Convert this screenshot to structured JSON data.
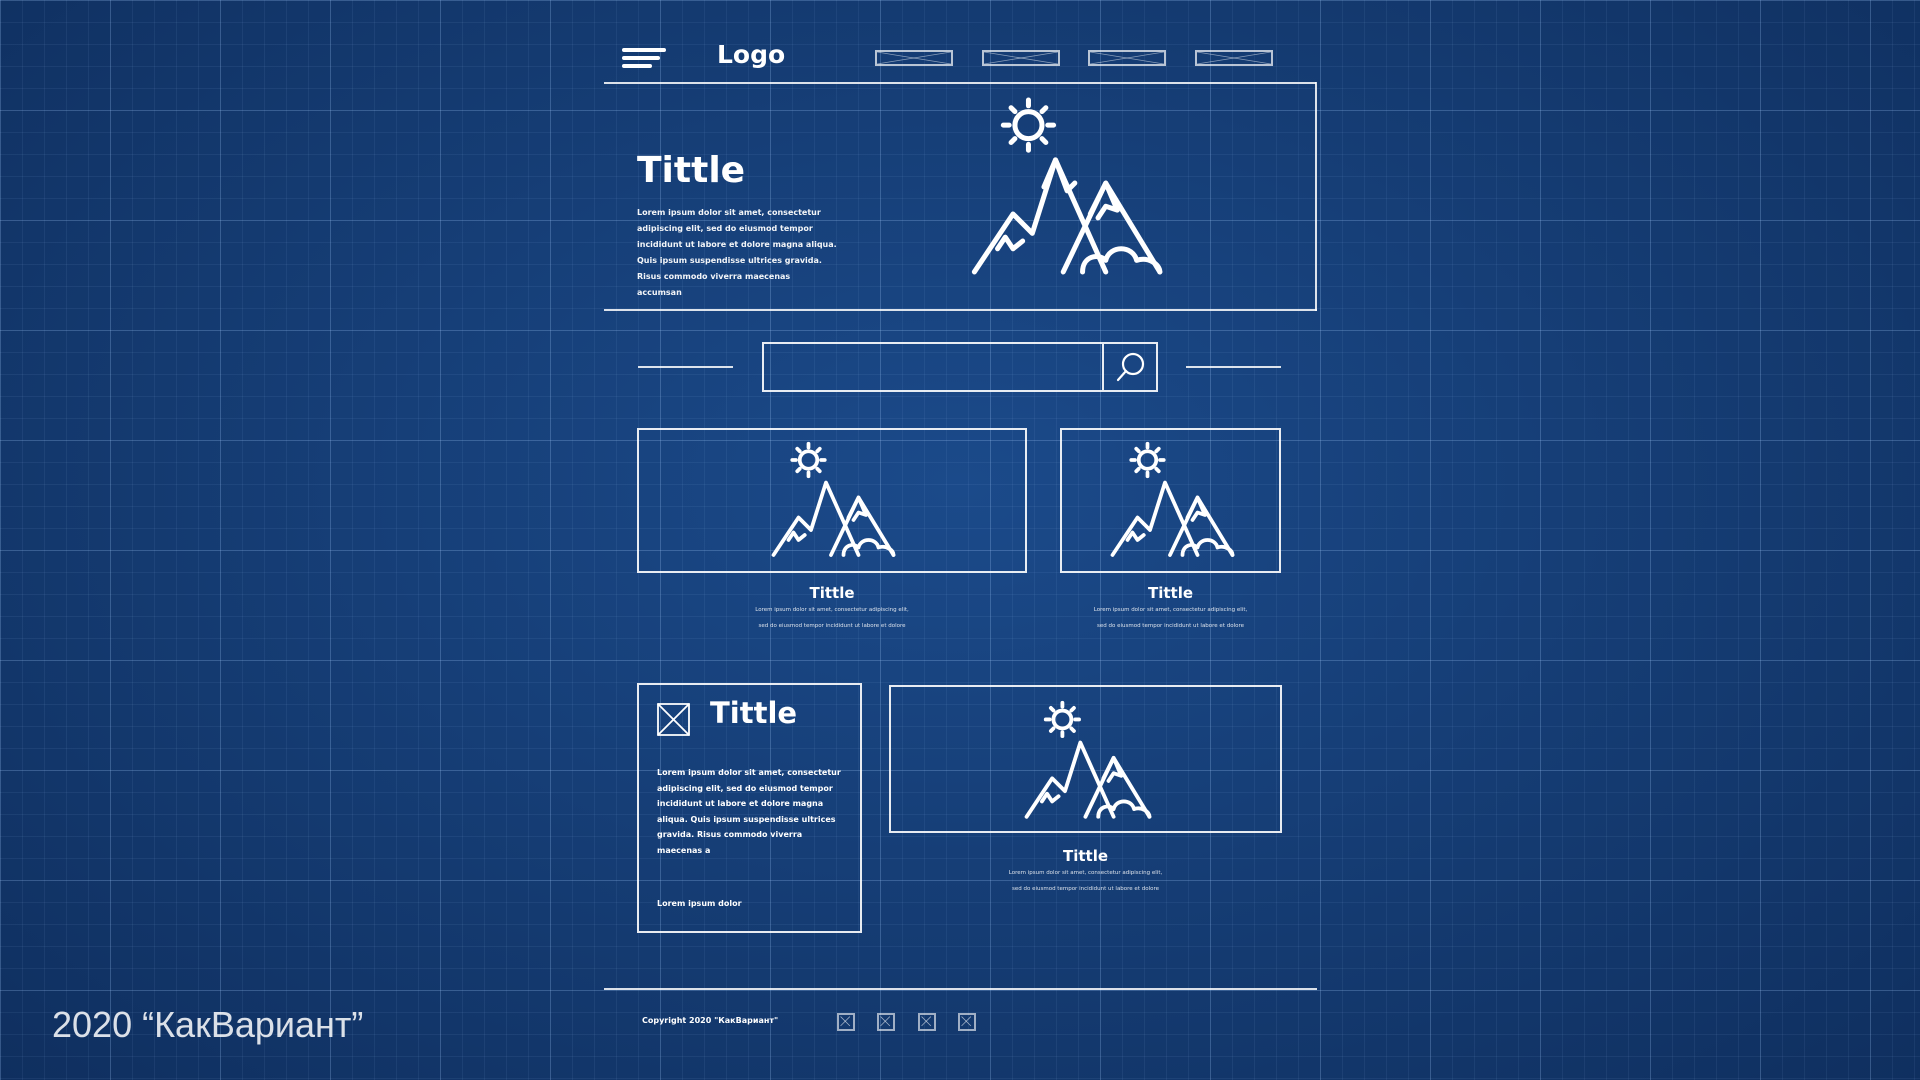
{
  "header": {
    "logo": "Logo",
    "nav_items": [
      "",
      "",
      "",
      ""
    ]
  },
  "hero": {
    "title": "Tittle",
    "text": "Lorem ipsum dolor sit amet, consectetur adipiscing elit, sed do eiusmod tempor incididunt ut labore et dolore magna aliqua. Quis ipsum suspendisse ultrices gravida. Risus commodo viverra maecenas accumsan"
  },
  "search": {
    "placeholder": ""
  },
  "cards": [
    {
      "title": "Tittle",
      "line1": "Lorem ipsum dolor sit amet, consectetur adipiscing elit,",
      "line2": "sed do eiusmod tempor incididunt ut labore et dolore"
    },
    {
      "title": "Tittle",
      "line1": "Lorem ipsum dolor sit amet, consectetur adipiscing elit,",
      "line2": "sed do eiusmod tempor incididunt ut labore et dolore"
    }
  ],
  "side_card": {
    "title": "Tittle",
    "text": "Lorem ipsum dolor sit amet, consectetur adipiscing elit, sed do eiusmod tempor incididunt ut labore et dolore magna aliqua. Quis ipsum suspendisse ultrices gravida. Risus commodo viverra maecenas a",
    "footer_text": "Lorem ipsum dolor"
  },
  "feature_card": {
    "title": "Tittle",
    "line1": "Lorem ipsum dolor sit amet, consectetur adipiscing elit,",
    "line2": "sed do eiusmod tempor incididunt ut labore et dolore"
  },
  "footer": {
    "copyright": "Copyright 2020 \"КакВариант\"",
    "social_icons": [
      "social-icon",
      "social-icon",
      "social-icon",
      "social-icon"
    ]
  },
  "watermark": "2020 “КакВариант”",
  "colors": {
    "background": "#163f77",
    "grid": "#96bef0",
    "line": "#ffffff"
  }
}
